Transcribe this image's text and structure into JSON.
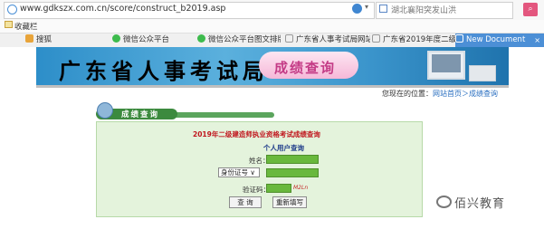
{
  "browser": {
    "url": "www.gdkszx.com.cn/score/construct_b2019.asp",
    "search_hint": "湖北襄阳突发山洪",
    "favorites_label": "收藏栏"
  },
  "tabs": [
    {
      "label": "搜狐",
      "active": false
    },
    {
      "label": "微信公众平台",
      "active": false
    },
    {
      "label": "微信公众平台图文排版",
      "active": false
    },
    {
      "label": "广东省人事考试局网站",
      "active": false
    },
    {
      "label": "广东省2019年度二级建",
      "active": false
    },
    {
      "label": "New Document",
      "active": true
    }
  ],
  "banner": {
    "title": "广东省人事考试局",
    "subtitle": "成绩查询"
  },
  "breadcrumb": {
    "prefix": "您现在的位置：",
    "link": "网站首页＞成绩查询"
  },
  "section": {
    "label": "成绩查询"
  },
  "form": {
    "title": "2019年二级建造师执业资格考试成绩查询",
    "subtitle": "个人用户查询",
    "name_label": "姓名：",
    "id_type": "身份证号",
    "captcha_label": "验证码：",
    "captcha_text": "M2Ln",
    "query_button": "查 询",
    "reset_button": "重新填写"
  },
  "watermark": "佰兴教育"
}
